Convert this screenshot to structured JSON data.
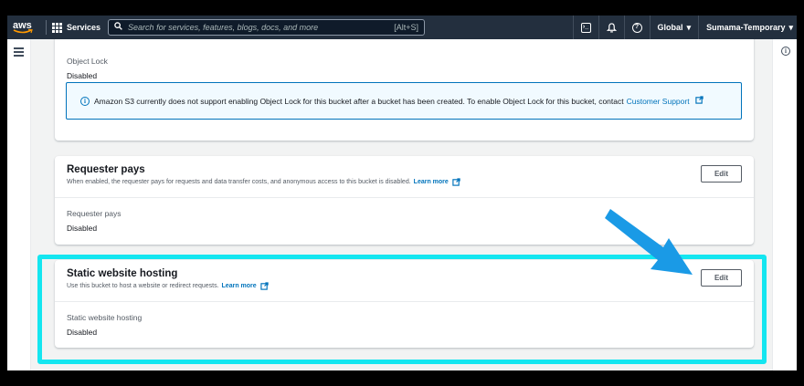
{
  "topnav": {
    "logo_text": "aws",
    "services_label": "Services",
    "search_placeholder": "Search for services, features, blogs, docs, and more",
    "search_shortcut": "[Alt+S]",
    "region_label": "Global",
    "account_label": "Sumama-Temporary"
  },
  "object_lock": {
    "label": "Object Lock",
    "value": "Disabled",
    "alert_text": "Amazon S3 currently does not support enabling Object Lock for this bucket after a bucket has been created. To enable Object Lock for this bucket, contact",
    "alert_link": "Customer Support"
  },
  "requester_pays": {
    "title": "Requester pays",
    "description": "When enabled, the requester pays for requests and data transfer costs, and anonymous access to this bucket is disabled.",
    "learn_more": "Learn more",
    "edit_label": "Edit",
    "prop_label": "Requester pays",
    "prop_value": "Disabled"
  },
  "static_hosting": {
    "title": "Static website hosting",
    "description": "Use this bucket to host a website or redirect requests.",
    "learn_more": "Learn more",
    "edit_label": "Edit",
    "prop_label": "Static website hosting",
    "prop_value": "Disabled"
  },
  "colors": {
    "nav_bg": "#232f3e",
    "link": "#0073bb",
    "highlight": "#14e6f0",
    "arrow": "#1a9ae6"
  }
}
